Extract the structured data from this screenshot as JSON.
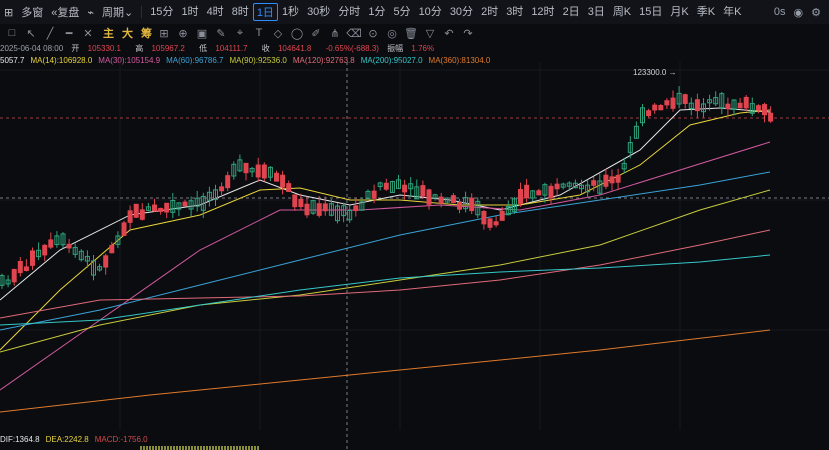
{
  "toolbar": {
    "logo": "多窗",
    "replay": "复盘",
    "period_label": "周期",
    "intervals": [
      "15分",
      "1时",
      "4时",
      "8时",
      "1日",
      "1秒",
      "30秒",
      "分时",
      "1分",
      "5分",
      "10分",
      "30分",
      "2时",
      "3时",
      "12时",
      "2日",
      "3日",
      "周K",
      "15日",
      "月K",
      "季K",
      "年K"
    ],
    "active_interval": "1日",
    "countdown": "0s"
  },
  "tools": {
    "indicator_tabs": [
      "主",
      "大",
      "筹"
    ]
  },
  "ohlc": {
    "date": "2025-06-04 08:00",
    "open_label": "开",
    "open": "105330.1",
    "high_label": "高",
    "high": "105967.2",
    "low_label": "低",
    "low": "104111.7",
    "close_label": "收",
    "close": "104641.8",
    "change": "-0.65%(-688.3)",
    "amp_label": "振幅",
    "amplitude": "1.76%"
  },
  "ma": [
    {
      "label": "5057.7",
      "color": "#e8e8e8"
    },
    {
      "label": "MA(14):106928.0",
      "color": "#e8d43a"
    },
    {
      "label": "MA(30):105154.9",
      "color": "#d35aa0"
    },
    {
      "label": "MA(60):96786.7",
      "color": "#3aa3d8"
    },
    {
      "label": "MA(90):92536.0",
      "color": "#c8cc3c"
    },
    {
      "label": "MA(120):92763.8",
      "color": "#e06a7a"
    },
    {
      "label": "MA(200):95027.0",
      "color": "#35c8c8"
    },
    {
      "label": "MA(360):81304.0",
      "color": "#e07a2a"
    }
  ],
  "annotations": {
    "peak": "123300.0"
  },
  "macd": [
    {
      "label": "DIF:1364.8",
      "color": "#e8e8e8"
    },
    {
      "label": "DEA:2242.8",
      "color": "#e8d43a"
    },
    {
      "label": "MACD:-1756.0",
      "color": "#d24a4a"
    }
  ],
  "colors": {
    "up": "#2ea37b",
    "down": "#e0454f",
    "bg": "#0b0c10"
  }
}
